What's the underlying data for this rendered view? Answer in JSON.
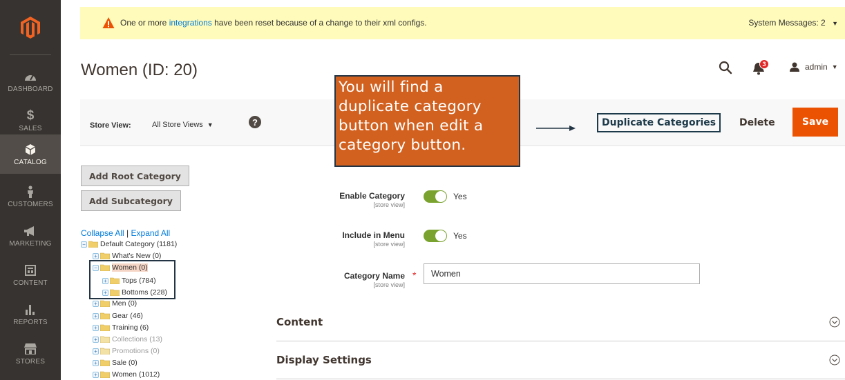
{
  "sidebar": {
    "items": [
      {
        "label": "DASHBOARD",
        "icon": "dashboard-gauge-icon"
      },
      {
        "label": "SALES",
        "icon": "dollar-icon"
      },
      {
        "label": "CATALOG",
        "icon": "catalog-box-icon"
      },
      {
        "label": "CUSTOMERS",
        "icon": "customers-person-icon"
      },
      {
        "label": "MARKETING",
        "icon": "megaphone-icon"
      },
      {
        "label": "CONTENT",
        "icon": "content-layout-icon"
      },
      {
        "label": "REPORTS",
        "icon": "bar-chart-icon"
      },
      {
        "label": "STORES",
        "icon": "store-icon"
      }
    ],
    "active": "CATALOG"
  },
  "system_message": {
    "prefix": "One or more",
    "link": "integrations",
    "suffix": "have been reset because of a change to their xml configs.",
    "counter": "System Messages: 2"
  },
  "header": {
    "title": "Women (ID: 20)",
    "notifications_count": "3",
    "user": "admin"
  },
  "actions": {
    "store_view_label": "Store View:",
    "store_view_value": "All Store Views",
    "help": "?",
    "duplicate_label": "Duplicate Categories",
    "delete_label": "Delete",
    "save_label": "Save"
  },
  "callout": {
    "text": "You will find a duplicate category button when edit a category button."
  },
  "tree": {
    "add_root": "Add Root Category",
    "add_sub": "Add Subcategory",
    "collapse_all": "Collapse All",
    "separator": "|",
    "expand_all": "Expand All",
    "nodes": [
      {
        "label": "Default Category (1181)"
      },
      {
        "label": "What's New (0)"
      },
      {
        "label": "Women (0)"
      },
      {
        "label": "Tops (784)"
      },
      {
        "label": "Bottoms (228)"
      },
      {
        "label": "Men (0)"
      },
      {
        "label": "Gear (46)"
      },
      {
        "label": "Training (6)"
      },
      {
        "label": "Collections (13)"
      },
      {
        "label": "Promotions (0)"
      },
      {
        "label": "Sale (0)"
      },
      {
        "label": "Women (1012)"
      }
    ]
  },
  "form": {
    "enable_label": "Enable Category",
    "enable_scope": "[store view]",
    "enable_value": "Yes",
    "menu_label": "Include in Menu",
    "menu_scope": "[store view]",
    "menu_value": "Yes",
    "name_label": "Category Name",
    "name_scope": "[store view]",
    "name_required": "*",
    "name_value": "Women"
  },
  "sections": {
    "content": "Content",
    "display": "Display Settings"
  },
  "colors": {
    "sidebar_bg": "#373330",
    "accent": "#eb5202",
    "callout_bg": "#d2601e",
    "toggle_on": "#79a22e",
    "link": "#007bdb"
  }
}
